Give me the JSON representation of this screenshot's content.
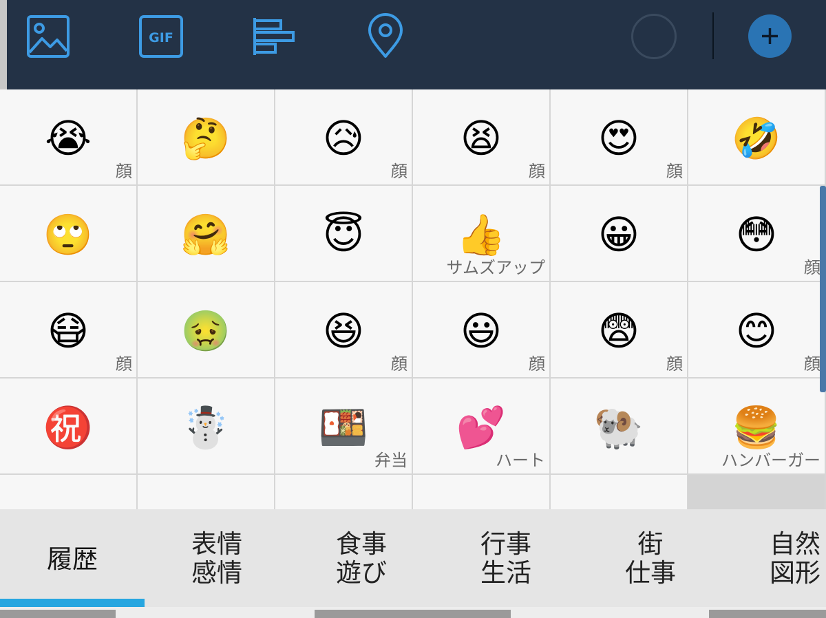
{
  "toolbar": {
    "icons": [
      {
        "name": "image-icon"
      },
      {
        "name": "gif-icon",
        "label": "GIF"
      },
      {
        "name": "text-align-icon"
      },
      {
        "name": "location-pin-icon"
      }
    ],
    "accent_color": "#3d9be4",
    "background_color": "#233246",
    "add_button_color": "#2a74b4"
  },
  "grid": {
    "rows": [
      [
        {
          "emoji": "😭",
          "label": "顔"
        },
        {
          "emoji": "🤔",
          "label": ""
        },
        {
          "emoji": "😥",
          "label": "顔"
        },
        {
          "emoji": "😫",
          "label": "顔"
        },
        {
          "emoji": "😍",
          "label": "顔"
        },
        {
          "emoji": "🤣",
          "label": ""
        }
      ],
      [
        {
          "emoji": "🙄",
          "label": ""
        },
        {
          "emoji": "🤗",
          "label": ""
        },
        {
          "emoji": "😇",
          "label": ""
        },
        {
          "emoji": "👍",
          "label": "サムズアップ"
        },
        {
          "emoji": "😀",
          "label": ""
        },
        {
          "emoji": "😳",
          "label": "顔"
        }
      ],
      [
        {
          "emoji": "😷",
          "label": "顔"
        },
        {
          "emoji": "🤢",
          "label": ""
        },
        {
          "emoji": "😆",
          "label": "顔"
        },
        {
          "emoji": "😃",
          "label": "顔"
        },
        {
          "emoji": "😨",
          "label": "顔"
        },
        {
          "emoji": "😊",
          "label": "顔"
        }
      ],
      [
        {
          "emoji": "㊗️",
          "label": ""
        },
        {
          "emoji": "☃️",
          "label": ""
        },
        {
          "emoji": "🍱",
          "label": "弁当"
        },
        {
          "emoji": "💕",
          "label": "ハート"
        },
        {
          "emoji": "🐏",
          "label": ""
        },
        {
          "emoji": "🍔",
          "label": "ハンバーガー"
        }
      ],
      [
        {
          "emoji": "",
          "label": ""
        },
        {
          "emoji": "",
          "label": ""
        },
        {
          "emoji": "",
          "label": ""
        },
        {
          "emoji": "",
          "label": ""
        },
        {
          "emoji": "",
          "label": ""
        },
        {
          "emoji": "",
          "label": "",
          "blank": true
        }
      ]
    ]
  },
  "tabs": [
    {
      "lines": [
        "履歴"
      ],
      "selected": true
    },
    {
      "lines": [
        "表情",
        "感情"
      ]
    },
    {
      "lines": [
        "食事",
        "遊び"
      ]
    },
    {
      "lines": [
        "行事",
        "生活"
      ]
    },
    {
      "lines": [
        "街",
        "仕事"
      ]
    },
    {
      "lines": [
        "自然",
        "図形"
      ]
    }
  ],
  "selected_tab_color": "#27a6e0"
}
